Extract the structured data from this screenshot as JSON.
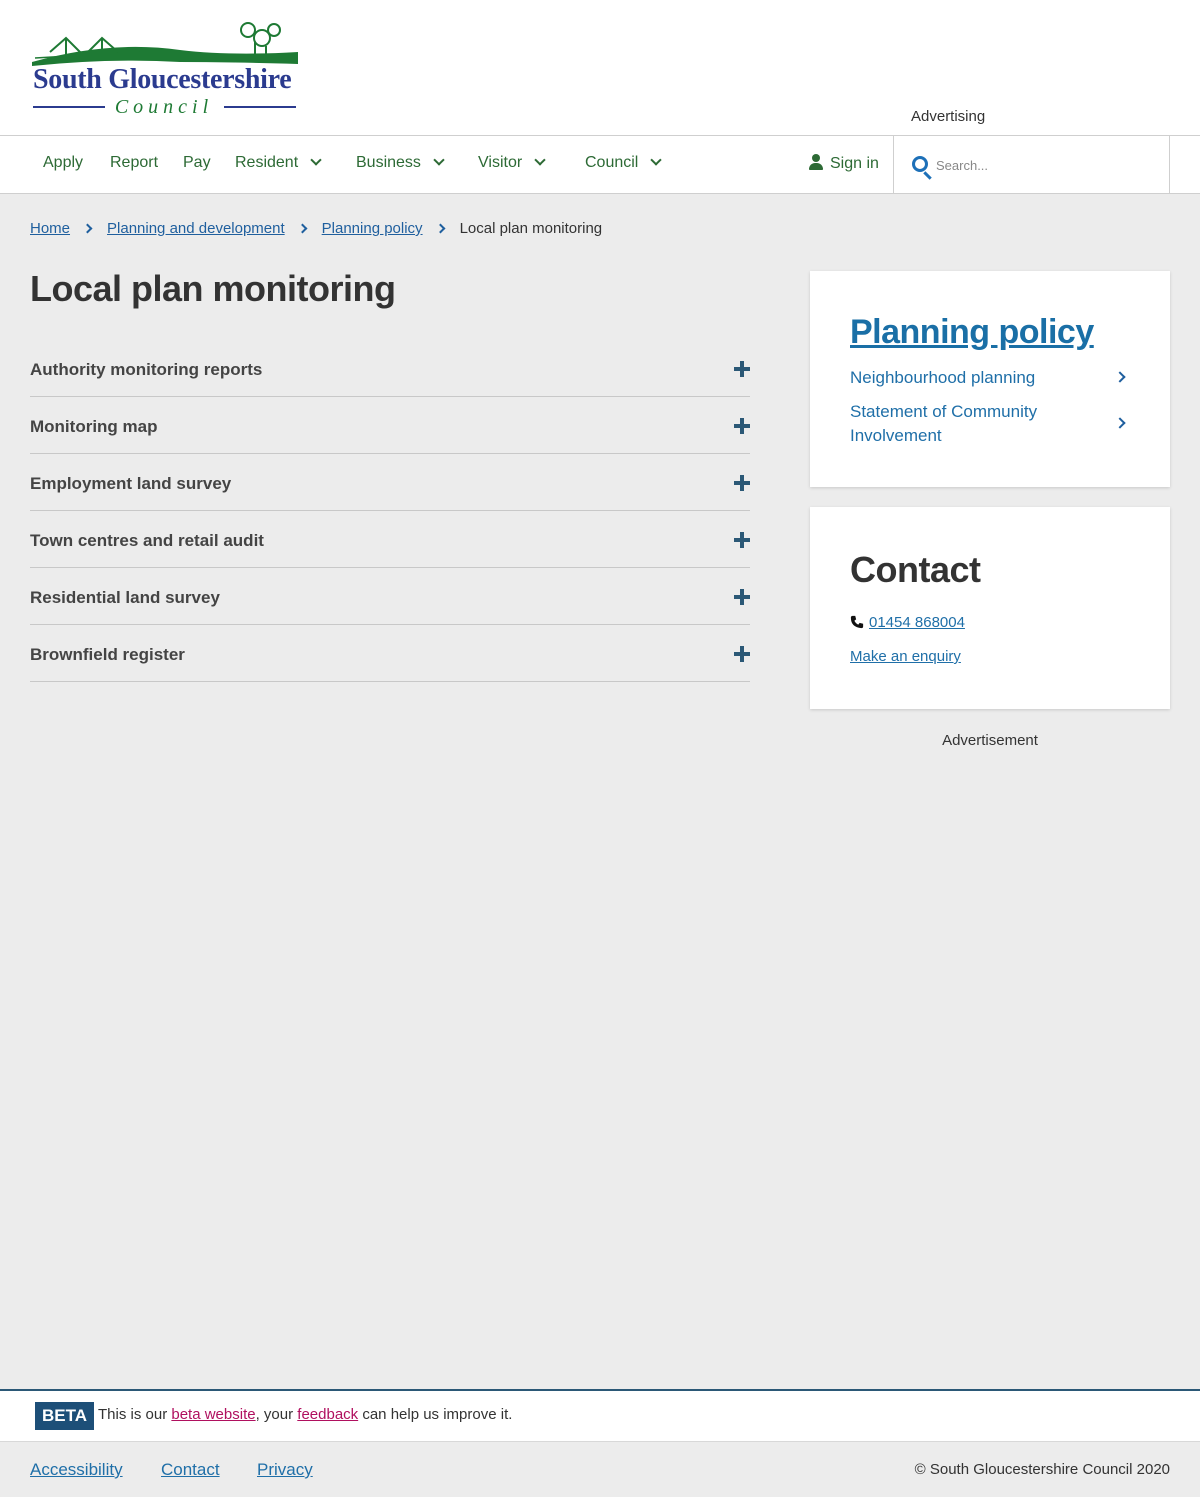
{
  "header": {
    "logo_name": "South Gloucestershire",
    "logo_sub": "Council",
    "advertising": "Advertising"
  },
  "nav": {
    "items": [
      {
        "label": "Apply"
      },
      {
        "label": "Report"
      },
      {
        "label": "Pay"
      },
      {
        "label": "Resident"
      },
      {
        "label": "Business"
      },
      {
        "label": "Visitor"
      },
      {
        "label": "Council"
      }
    ],
    "signin": "Sign in",
    "search_placeholder": "Search..."
  },
  "breadcrumb": {
    "items": [
      {
        "label": "Home"
      },
      {
        "label": "Planning and development"
      },
      {
        "label": "Planning policy"
      }
    ],
    "current": "Local plan monitoring"
  },
  "main": {
    "title": "Local plan monitoring",
    "accordion": [
      {
        "label": "Authority monitoring reports"
      },
      {
        "label": "Monitoring map"
      },
      {
        "label": "Employment land survey"
      },
      {
        "label": "Town centres and retail audit"
      },
      {
        "label": "Residential land survey"
      },
      {
        "label": "Brownfield register"
      }
    ]
  },
  "sidebar": {
    "policy_title": "Planning policy",
    "links": [
      {
        "label": "Neighbourhood planning"
      },
      {
        "label": "Statement of Community Involvement"
      }
    ],
    "contact_title": "Contact",
    "phone": "01454 868004",
    "enquiry": "Make an enquiry",
    "advertisement": "Advertisement"
  },
  "beta": {
    "tag": "BETA",
    "prefix": "This is our ",
    "link1": "beta website",
    "middle": ", your ",
    "link2": "feedback",
    "suffix": " can help us improve it."
  },
  "footer": {
    "links": [
      {
        "label": "Accessibility"
      },
      {
        "label": "Contact"
      },
      {
        "label": "Privacy"
      }
    ],
    "copyright": "© South Gloucestershire Council 2020"
  },
  "colors": {
    "nav_green": "#2d6a35",
    "link_blue": "#1f6fa8",
    "beta_pink": "#b0105f",
    "logo_blue": "#2b3b8f"
  }
}
